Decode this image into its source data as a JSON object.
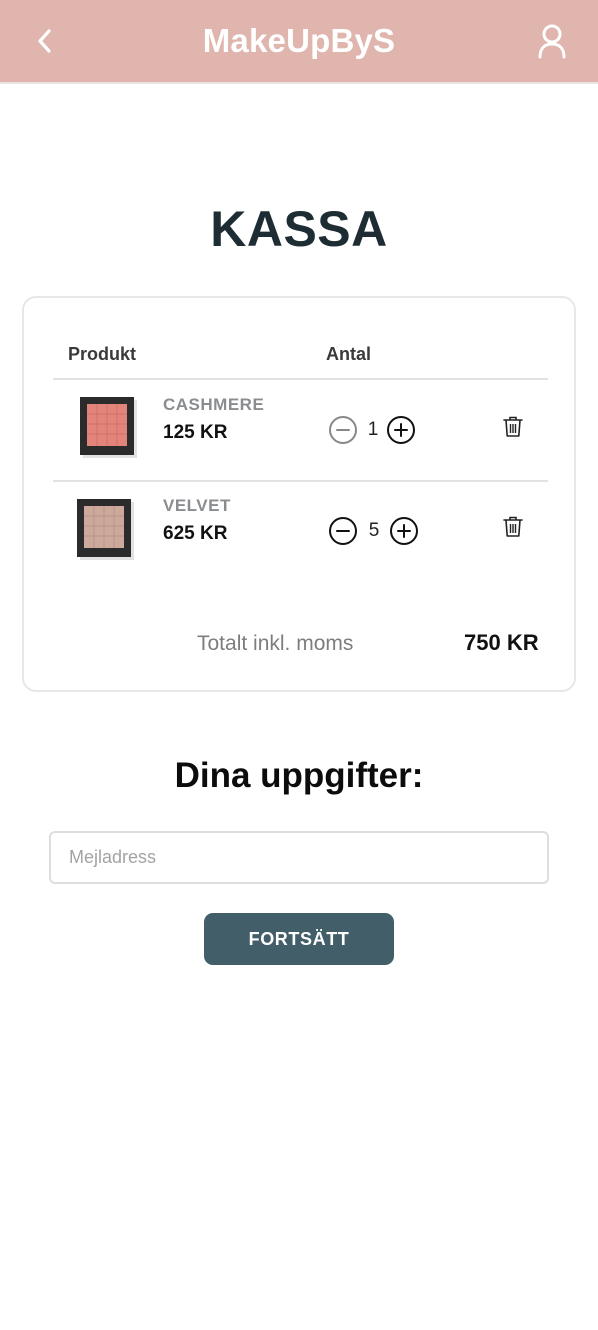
{
  "header": {
    "brand": "MakeUpByS",
    "back_icon": "chevron-left-icon",
    "user_icon": "user-icon",
    "background": "#dfb5ad"
  },
  "page": {
    "title": "KASSA"
  },
  "cart": {
    "columns": {
      "product": "Produkt",
      "quantity": "Antal"
    },
    "items": [
      {
        "name": "CASHMERE",
        "price": "125 KR",
        "quantity": "1",
        "swatch_color": "#e3847a"
      },
      {
        "name": "VELVET",
        "price": "625 KR",
        "quantity": "5",
        "swatch_color": "#cda99b"
      }
    ],
    "total_label": "Totalt inkl. moms",
    "total_value": "750 KR",
    "icons": {
      "decrease": "minus-circle-icon",
      "increase": "plus-circle-icon",
      "delete": "trash-icon"
    }
  },
  "details": {
    "title": "Dina uppgifter:",
    "email_placeholder": "Mejladress",
    "email_value": "",
    "continue_label": "FORTSÄTT",
    "button_color": "#425e69"
  }
}
